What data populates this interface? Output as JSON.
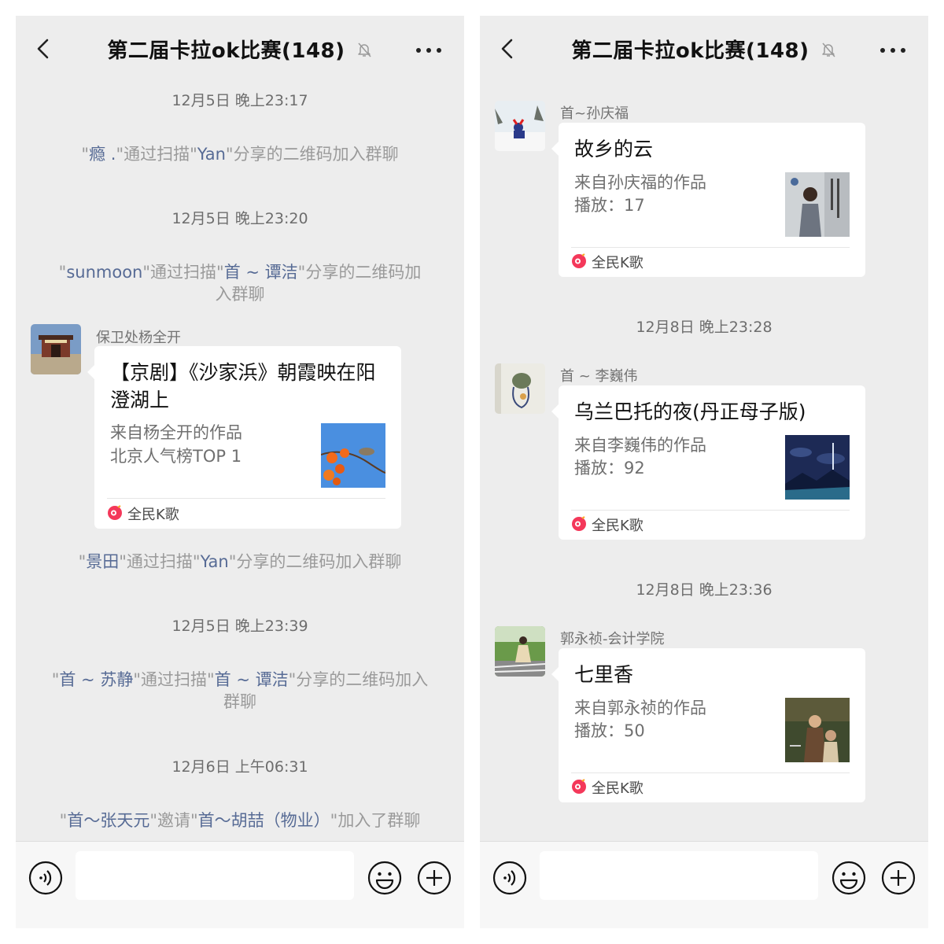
{
  "left": {
    "header": {
      "title": "第二届卡拉ok比赛(148)"
    },
    "times": [
      "12月5日 晚上23:17",
      "12月5日 晚上23:20",
      "12月5日 晚上23:39",
      "12月6日 上午06:31"
    ],
    "sys1": {
      "q1": "\"",
      "name1": "瘾 .",
      "q2": "\"通过扫描\"",
      "name2": "Yan",
      "tail": "\"分享的二维码加入群聊"
    },
    "sys2": {
      "q1": "\"",
      "name1": "sunmoon",
      "q2": "\"通过扫描\"",
      "name2": "首 ~ 谭洁",
      "tail": "\"分享的二维码加入群聊"
    },
    "sys3": {
      "q1": "\"",
      "name1": "景田",
      "q2": "\"通过扫描\"",
      "name2": "Yan",
      "tail": "\"分享的二维码加入群聊"
    },
    "sys4": {
      "q1": "\"",
      "name1": "首 ~ 苏静",
      "q2": "\"通过扫描\"",
      "name2": "首 ~ 谭洁",
      "tail": "\"分享的二维码加入群聊"
    },
    "sys5": {
      "q1": "\"",
      "name1": "首～张天元",
      "q2": "\"邀请\"",
      "name2": "首～胡喆（物业）",
      "tail": "\"加入了群聊"
    },
    "msg": {
      "sender": "保卫处杨全开",
      "title": "【京剧】《沙家浜》朝霞映在阳澄湖上",
      "line1": "来自杨全开的作品",
      "line2": "北京人气榜TOP 1",
      "source": "全民K歌"
    }
  },
  "right": {
    "header": {
      "title": "第二届卡拉ok比赛(148)"
    },
    "times": [
      "12月8日 晚上23:28",
      "12月8日 晚上23:36"
    ],
    "msgs": [
      {
        "sender": "首~孙庆福",
        "title": "故乡的云",
        "line1": "来自孙庆福的作品",
        "line2": "播放：17",
        "source": "全民K歌"
      },
      {
        "sender": "首 ~ 李巍伟",
        "title": "乌兰巴托的夜(丹正母子版)",
        "line1": "来自李巍伟的作品",
        "line2": "播放：92",
        "source": "全民K歌"
      },
      {
        "sender": "郭永祯-会计学院",
        "title": "七里香",
        "line1": "来自郭永祯的作品",
        "line2": "播放：50",
        "source": "全民K歌"
      }
    ]
  },
  "colors": {
    "background": "#ededed",
    "name_link": "#576b95",
    "system_text": "#9a9a9a",
    "card": "#ffffff",
    "brand": "#f4385a"
  }
}
